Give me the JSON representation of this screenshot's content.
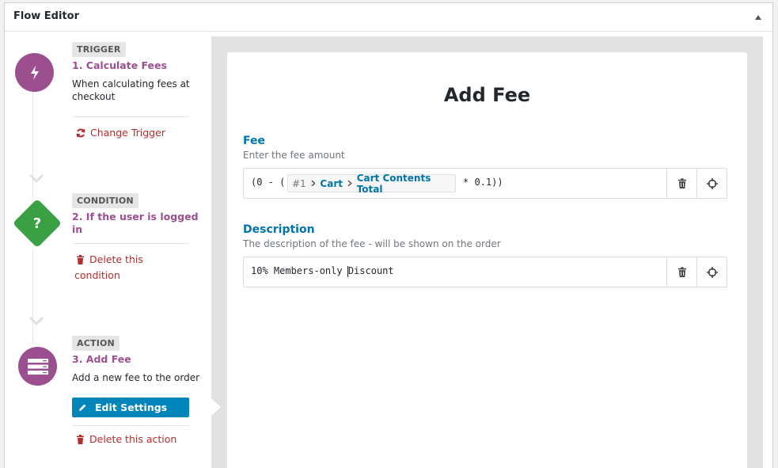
{
  "panel": {
    "title": "Flow Editor"
  },
  "steps": {
    "trigger": {
      "tag": "TRIGGER",
      "title": "1. Calculate Fees",
      "description_line1": "When calculating fees at",
      "description_line2": "checkout",
      "link": "Change Trigger"
    },
    "condition": {
      "tag": "CONDITION",
      "title_line1": "2. If the user is logged",
      "title_line2": "in",
      "icon_glyph": "?",
      "link_line1": "Delete this",
      "link_line2": "condition"
    },
    "action": {
      "tag": "ACTION",
      "title": "3. Add Fee",
      "description": "Add a new fee to the order",
      "edit_button": "Edit Settings",
      "link": "Delete this action"
    }
  },
  "editor": {
    "title": "Add Fee",
    "fee": {
      "label": "Fee",
      "help": "Enter the fee amount",
      "value_prefix": "(0 - (",
      "token": {
        "number": "#1",
        "part1": "Cart",
        "part2": "Cart Contents Total"
      },
      "value_suffix": "* 0.1))"
    },
    "description": {
      "label": "Description",
      "help": "The description of the fee - will be shown on the order",
      "value": "10% Members-only Discount"
    }
  },
  "colors": {
    "step_purple": "#9b4f8f",
    "condition_green": "#3b9f44",
    "link_red": "#b32d2e",
    "label_blue": "#0073aa",
    "button_blue": "#0085ba"
  }
}
